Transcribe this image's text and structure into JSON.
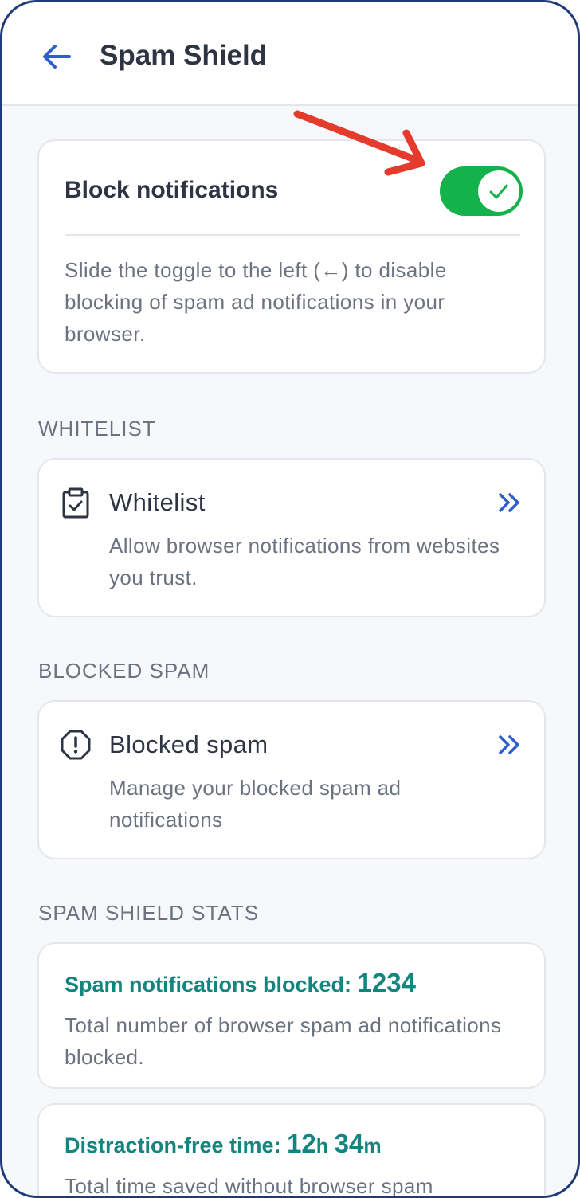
{
  "header": {
    "title": "Spam Shield"
  },
  "block_notifications": {
    "title": "Block notifications",
    "enabled": true,
    "description": "Slide the toggle to the left (←) to disable blocking of spam ad notifications in your browser."
  },
  "sections": {
    "whitelist_label": "WHITELIST",
    "blocked_label": "BLOCKED SPAM",
    "stats_label": "SPAM SHIELD STATS"
  },
  "whitelist": {
    "title": "Whitelist",
    "description": "Allow browser notifications from websites you trust.",
    "icon": "clipboard-check-icon"
  },
  "blocked": {
    "title": "Blocked spam",
    "description": "Manage your blocked spam ad notifications",
    "icon": "alert-octagon-icon"
  },
  "stats": {
    "blocked": {
      "label": "Spam notifications blocked:",
      "value": "1234",
      "description": "Total number of browser spam ad notifications blocked."
    },
    "time": {
      "label": "Distraction-free time:",
      "hours": "12",
      "hours_unit": "h",
      "minutes": "34",
      "minutes_unit": "m",
      "description": "Total time saved without browser spam"
    }
  },
  "colors": {
    "accent_blue": "#2f5fc8",
    "toggle_green": "#14b24a",
    "stat_teal": "#13857e",
    "annotation_red": "#e53b2c"
  }
}
